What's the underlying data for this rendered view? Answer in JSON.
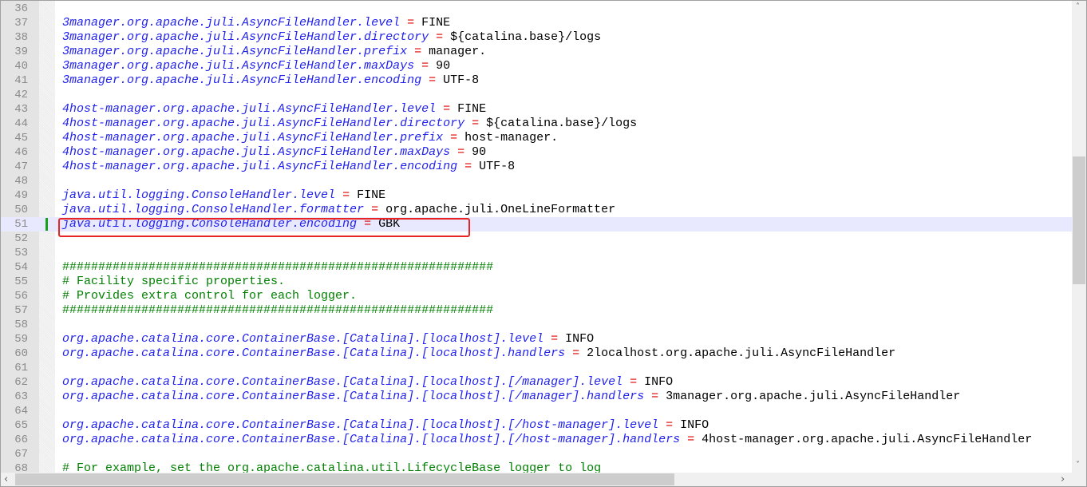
{
  "editor": {
    "current_line": 51,
    "changed_line": 51,
    "highlighted_line": 51,
    "lines": [
      {
        "n": "36"
      },
      {
        "n": "37",
        "key": "3manager.org.apache.juli.AsyncFileHandler.level",
        "eq": " = ",
        "val": "FINE"
      },
      {
        "n": "38",
        "key": "3manager.org.apache.juli.AsyncFileHandler.directory",
        "eq": " = ",
        "val": "${catalina.base}/logs"
      },
      {
        "n": "39",
        "key": "3manager.org.apache.juli.AsyncFileHandler.prefix",
        "eq": " = ",
        "val": "manager."
      },
      {
        "n": "40",
        "key": "3manager.org.apache.juli.AsyncFileHandler.maxDays",
        "eq": " = ",
        "val": "90"
      },
      {
        "n": "41",
        "key": "3manager.org.apache.juli.AsyncFileHandler.encoding",
        "eq": " = ",
        "val": "UTF-8"
      },
      {
        "n": "42"
      },
      {
        "n": "43",
        "key": "4host-manager.org.apache.juli.AsyncFileHandler.level",
        "eq": " = ",
        "val": "FINE"
      },
      {
        "n": "44",
        "key": "4host-manager.org.apache.juli.AsyncFileHandler.directory",
        "eq": " = ",
        "val": "${catalina.base}/logs"
      },
      {
        "n": "45",
        "key": "4host-manager.org.apache.juli.AsyncFileHandler.prefix",
        "eq": " = ",
        "val": "host-manager."
      },
      {
        "n": "46",
        "key": "4host-manager.org.apache.juli.AsyncFileHandler.maxDays",
        "eq": " = ",
        "val": "90"
      },
      {
        "n": "47",
        "key": "4host-manager.org.apache.juli.AsyncFileHandler.encoding",
        "eq": " = ",
        "val": "UTF-8"
      },
      {
        "n": "48"
      },
      {
        "n": "49",
        "key": "java.util.logging.ConsoleHandler.level",
        "eq": " = ",
        "val": "FINE"
      },
      {
        "n": "50",
        "key": "java.util.logging.ConsoleHandler.formatter",
        "eq": " = ",
        "val": "org.apache.juli.OneLineFormatter"
      },
      {
        "n": "51",
        "key": "java.util.logging.ConsoleHandler.encoding",
        "eq": " = ",
        "val": "GBK"
      },
      {
        "n": "52"
      },
      {
        "n": "53"
      },
      {
        "n": "54",
        "cmt": "############################################################"
      },
      {
        "n": "55",
        "cmt": "# Facility specific properties."
      },
      {
        "n": "56",
        "cmt": "# Provides extra control for each logger."
      },
      {
        "n": "57",
        "cmt": "############################################################"
      },
      {
        "n": "58"
      },
      {
        "n": "59",
        "key": "org.apache.catalina.core.ContainerBase.[Catalina].[localhost].level",
        "eq": " = ",
        "val": "INFO"
      },
      {
        "n": "60",
        "key": "org.apache.catalina.core.ContainerBase.[Catalina].[localhost].handlers",
        "eq": " = ",
        "val": "2localhost.org.apache.juli.AsyncFileHandler"
      },
      {
        "n": "61"
      },
      {
        "n": "62",
        "key": "org.apache.catalina.core.ContainerBase.[Catalina].[localhost].[/manager].level",
        "eq": " = ",
        "val": "INFO"
      },
      {
        "n": "63",
        "key": "org.apache.catalina.core.ContainerBase.[Catalina].[localhost].[/manager].handlers",
        "eq": " = ",
        "val": "3manager.org.apache.juli.AsyncFileHandler"
      },
      {
        "n": "64"
      },
      {
        "n": "65",
        "key": "org.apache.catalina.core.ContainerBase.[Catalina].[localhost].[/host-manager].level",
        "eq": " = ",
        "val": "INFO"
      },
      {
        "n": "66",
        "key": "org.apache.catalina.core.ContainerBase.[Catalina].[localhost].[/host-manager].handlers",
        "eq": " = ",
        "val": "4host-manager.org.apache.juli.AsyncFileHandler"
      },
      {
        "n": "67"
      },
      {
        "n": "68",
        "cmt": "# For example, set the org.apache.catalina.util.LifecycleBase logger to log"
      }
    ]
  },
  "scrollbars": {
    "up_arrow": "˄",
    "down_arrow": "˅",
    "left_arrow": "‹",
    "right_arrow": "›"
  }
}
